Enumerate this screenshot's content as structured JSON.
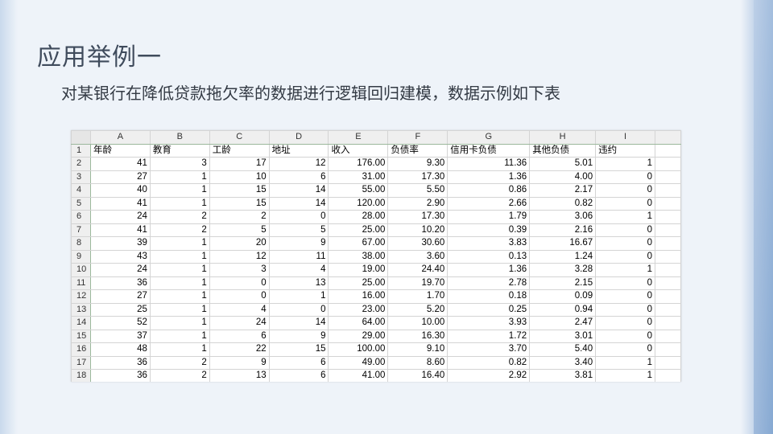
{
  "slide": {
    "title": "应用举例一",
    "subtitle": "对某银行在降低贷款拖欠率的数据进行逻辑回归建模，数据示例如下表"
  },
  "sheet": {
    "column_letters": [
      "A",
      "B",
      "C",
      "D",
      "E",
      "F",
      "G",
      "H",
      "I"
    ],
    "header_row_number": "1",
    "headers": [
      "年龄",
      "教育",
      "工龄",
      "地址",
      "收入",
      "负债率",
      "信用卡负债",
      "其他负债",
      "违约"
    ],
    "rows": [
      {
        "n": "2",
        "cells": [
          "41",
          "3",
          "17",
          "12",
          "176.00",
          "9.30",
          "11.36",
          "5.01",
          "1"
        ]
      },
      {
        "n": "3",
        "cells": [
          "27",
          "1",
          "10",
          "6",
          "31.00",
          "17.30",
          "1.36",
          "4.00",
          "0"
        ]
      },
      {
        "n": "4",
        "cells": [
          "40",
          "1",
          "15",
          "14",
          "55.00",
          "5.50",
          "0.86",
          "2.17",
          "0"
        ]
      },
      {
        "n": "5",
        "cells": [
          "41",
          "1",
          "15",
          "14",
          "120.00",
          "2.90",
          "2.66",
          "0.82",
          "0"
        ]
      },
      {
        "n": "6",
        "cells": [
          "24",
          "2",
          "2",
          "0",
          "28.00",
          "17.30",
          "1.79",
          "3.06",
          "1"
        ]
      },
      {
        "n": "7",
        "cells": [
          "41",
          "2",
          "5",
          "5",
          "25.00",
          "10.20",
          "0.39",
          "2.16",
          "0"
        ]
      },
      {
        "n": "8",
        "cells": [
          "39",
          "1",
          "20",
          "9",
          "67.00",
          "30.60",
          "3.83",
          "16.67",
          "0"
        ]
      },
      {
        "n": "9",
        "cells": [
          "43",
          "1",
          "12",
          "11",
          "38.00",
          "3.60",
          "0.13",
          "1.24",
          "0"
        ]
      },
      {
        "n": "10",
        "cells": [
          "24",
          "1",
          "3",
          "4",
          "19.00",
          "24.40",
          "1.36",
          "3.28",
          "1"
        ]
      },
      {
        "n": "11",
        "cells": [
          "36",
          "1",
          "0",
          "13",
          "25.00",
          "19.70",
          "2.78",
          "2.15",
          "0"
        ]
      },
      {
        "n": "12",
        "cells": [
          "27",
          "1",
          "0",
          "1",
          "16.00",
          "1.70",
          "0.18",
          "0.09",
          "0"
        ]
      },
      {
        "n": "13",
        "cells": [
          "25",
          "1",
          "4",
          "0",
          "23.00",
          "5.20",
          "0.25",
          "0.94",
          "0"
        ]
      },
      {
        "n": "14",
        "cells": [
          "52",
          "1",
          "24",
          "14",
          "64.00",
          "10.00",
          "3.93",
          "2.47",
          "0"
        ]
      },
      {
        "n": "15",
        "cells": [
          "37",
          "1",
          "6",
          "9",
          "29.00",
          "16.30",
          "1.72",
          "3.01",
          "0"
        ]
      },
      {
        "n": "16",
        "cells": [
          "48",
          "1",
          "22",
          "15",
          "100.00",
          "9.10",
          "3.70",
          "5.40",
          "0"
        ]
      },
      {
        "n": "17",
        "cells": [
          "36",
          "2",
          "9",
          "6",
          "49.00",
          "8.60",
          "0.82",
          "3.40",
          "1"
        ]
      },
      {
        "n": "18",
        "cells": [
          "36",
          "2",
          "13",
          "6",
          "41.00",
          "16.40",
          "2.92",
          "3.81",
          "1"
        ]
      }
    ]
  }
}
